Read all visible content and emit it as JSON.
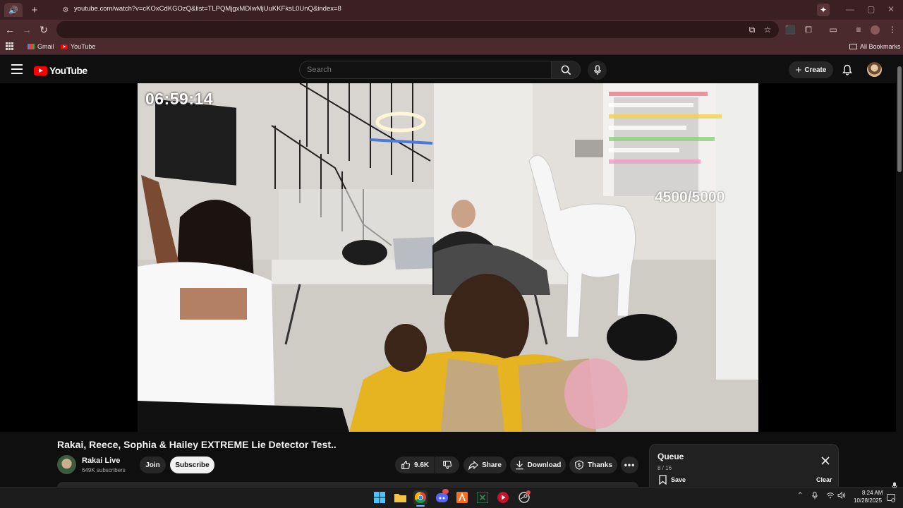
{
  "browser": {
    "url": "youtube.com/watch?v=cKOxCdKGOzQ&list=TLPQMjgxMDIwMjUuKKFksL0UnQ&index=8",
    "bookmarks": [
      {
        "label": "Gmail",
        "icon": "gmail-icon"
      },
      {
        "label": "YouTube",
        "icon": "youtube-icon"
      }
    ],
    "all_bookmarks_label": "All Bookmarks"
  },
  "youtube": {
    "logo_text": "YouTube",
    "search_placeholder": "Search",
    "create_label": "Create"
  },
  "video": {
    "overlay_timer": "06:59:14",
    "overlay_counter": "4500/5000",
    "title": "Rakai, Reece, Sophia & Hailey EXTREME Lie Detector Test..",
    "channel_name": "Rakai Live",
    "subscribers": "649K subscribers",
    "join_label": "Join",
    "subscribe_label": "Subscribe",
    "likes": "9.6K",
    "share_label": "Share",
    "download_label": "Download",
    "thanks_label": "Thanks"
  },
  "queue": {
    "title": "Queue",
    "position": "8 / 16",
    "save_label": "Save",
    "clear_label": "Clear"
  },
  "taskbar": {
    "time": "8:24 AM",
    "date": "10/28/2025",
    "apps": [
      "windows-start",
      "file-explorer",
      "chrome",
      "discord",
      "app-orange",
      "excel",
      "media-player",
      "steam"
    ]
  }
}
